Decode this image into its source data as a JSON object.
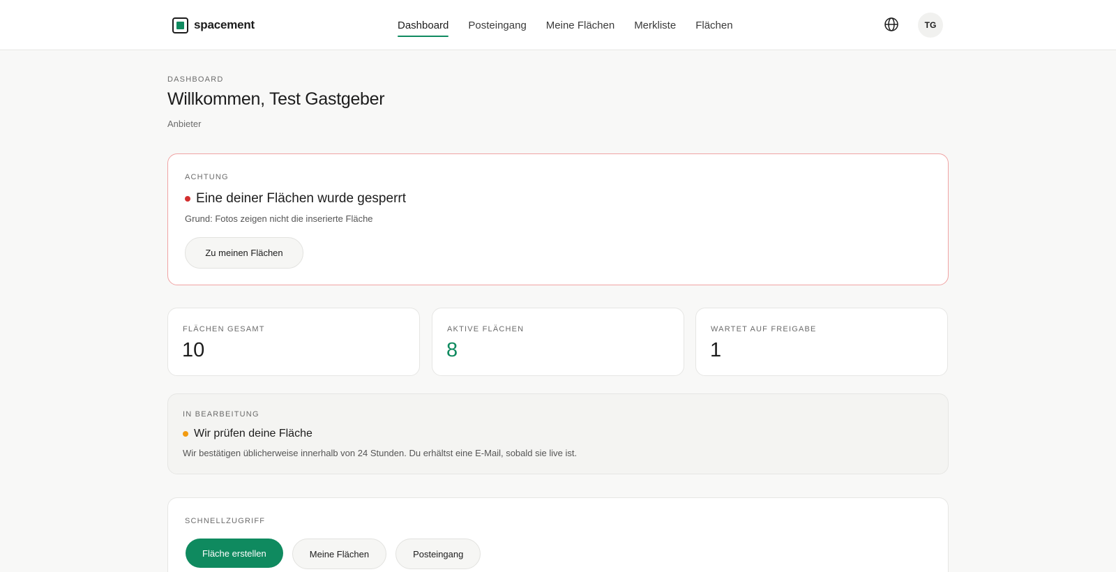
{
  "brand": {
    "name": "spacement",
    "icon": "brand-logo-icon",
    "accent": "#0f8a5f"
  },
  "nav": {
    "items": [
      {
        "label": "Dashboard",
        "active": true
      },
      {
        "label": "Posteingang",
        "active": false
      },
      {
        "label": "Meine Flächen",
        "active": false
      },
      {
        "label": "Merkliste",
        "active": false
      },
      {
        "label": "Flächen",
        "active": false
      }
    ],
    "language_icon": "globe-icon",
    "avatar_initials": "TG"
  },
  "header": {
    "eyebrow": "DASHBOARD",
    "title": "Willkommen, Test Gastgeber",
    "subtitle": "Anbieter"
  },
  "alert": {
    "eyebrow": "ACHTUNG",
    "title": "Eine deiner Flächen wurde gesperrt",
    "reason": "Grund: Fotos zeigen nicht die inserierte Fläche",
    "button": "Zu meinen Flächen",
    "status_color": "#d32f2f"
  },
  "stats": [
    {
      "label": "FLÄCHEN GESAMT",
      "value": "10"
    },
    {
      "label": "AKTIVE FLÄCHEN",
      "value": "8"
    },
    {
      "label": "WARTET AUF FREIGABE",
      "value": "1"
    }
  ],
  "processing": {
    "eyebrow": "IN BEARBEITUNG",
    "title": "Wir prüfen deine Fläche",
    "description": "Wir bestätigen üblicherweise innerhalb von 24 Stunden. Du erhältst eine E-Mail, sobald sie live ist.",
    "status_color": "#f29b11"
  },
  "quick_access": {
    "eyebrow": "SCHNELLZUGRIFF",
    "buttons": [
      {
        "label": "Fläche erstellen",
        "primary": true
      },
      {
        "label": "Meine Flächen",
        "primary": false
      },
      {
        "label": "Posteingang",
        "primary": false
      }
    ]
  }
}
